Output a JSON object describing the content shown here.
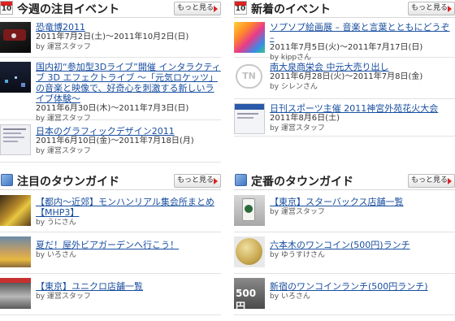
{
  "more_label": "もっと見る",
  "weekly_events": {
    "title": "今週の注目イベント",
    "calendar_num": "10",
    "items": [
      {
        "title": "恐竜博2011",
        "date": "2011年7月2日(土)～2011年10月2日(日)",
        "by": "by 運営スタッフ"
      },
      {
        "title": "国内初“参加型3Dライブ”開催 インタラクティブ 3D エフェクトライブ ～「元気ロケッツ」の音楽と映像で、好奇心を刺激する新しいライブ体験～",
        "date": "2011年6月30日(木)～2011年7月3日(日)",
        "by": "by 運営スタッフ"
      },
      {
        "title": "日本のグラフィックデザイン2011",
        "date": "2011年6月10日(金)～2011年7月18日(月)",
        "by": "by 運営スタッフ"
      }
    ]
  },
  "new_events": {
    "title": "新着のイベント",
    "calendar_num": "10",
    "items": [
      {
        "title": "ソプソプ絵画展 – 音楽と言葉とともにどうぞ –",
        "date": "2011年7月5日(火)～2011年7月17日(日)",
        "by": "by kippさん"
      },
      {
        "title": "南大泉商栄会 中元大売り出し",
        "date": "2011年6月28日(火)～2011年7月8日(金)",
        "by": "by シレンさん",
        "thumb_text": "TN"
      },
      {
        "title": "日刊スポーツ主催 2011神宮外苑花火大会",
        "date": "2011年8月6日(土)",
        "by": "by 運営スタッフ"
      }
    ]
  },
  "featured_guides": {
    "title": "注目のタウンガイド",
    "items": [
      {
        "title": "【都内～近郊】モンハンリアル集会所まとめ【MHP3】",
        "by": "by うにさん"
      },
      {
        "title": "夏だ！屋外ビアガーデンへ行こう！",
        "by": "by いろさん"
      },
      {
        "title": "【東京】ユニクロ店舗一覧",
        "by": "by 運営スタッフ"
      }
    ]
  },
  "standard_guides": {
    "title": "定番のタウンガイド",
    "items": [
      {
        "title": "【東京】スターバックス店舗一覧",
        "by": "by 運営スタッフ"
      },
      {
        "title": "六本木のワンコイン(500円)ランチ",
        "by": "by ゆうすけさん"
      },
      {
        "title": "新宿のワンコインランチ(500円ランチ)",
        "by": "by いろさん",
        "thumb_text": "500円"
      }
    ]
  }
}
